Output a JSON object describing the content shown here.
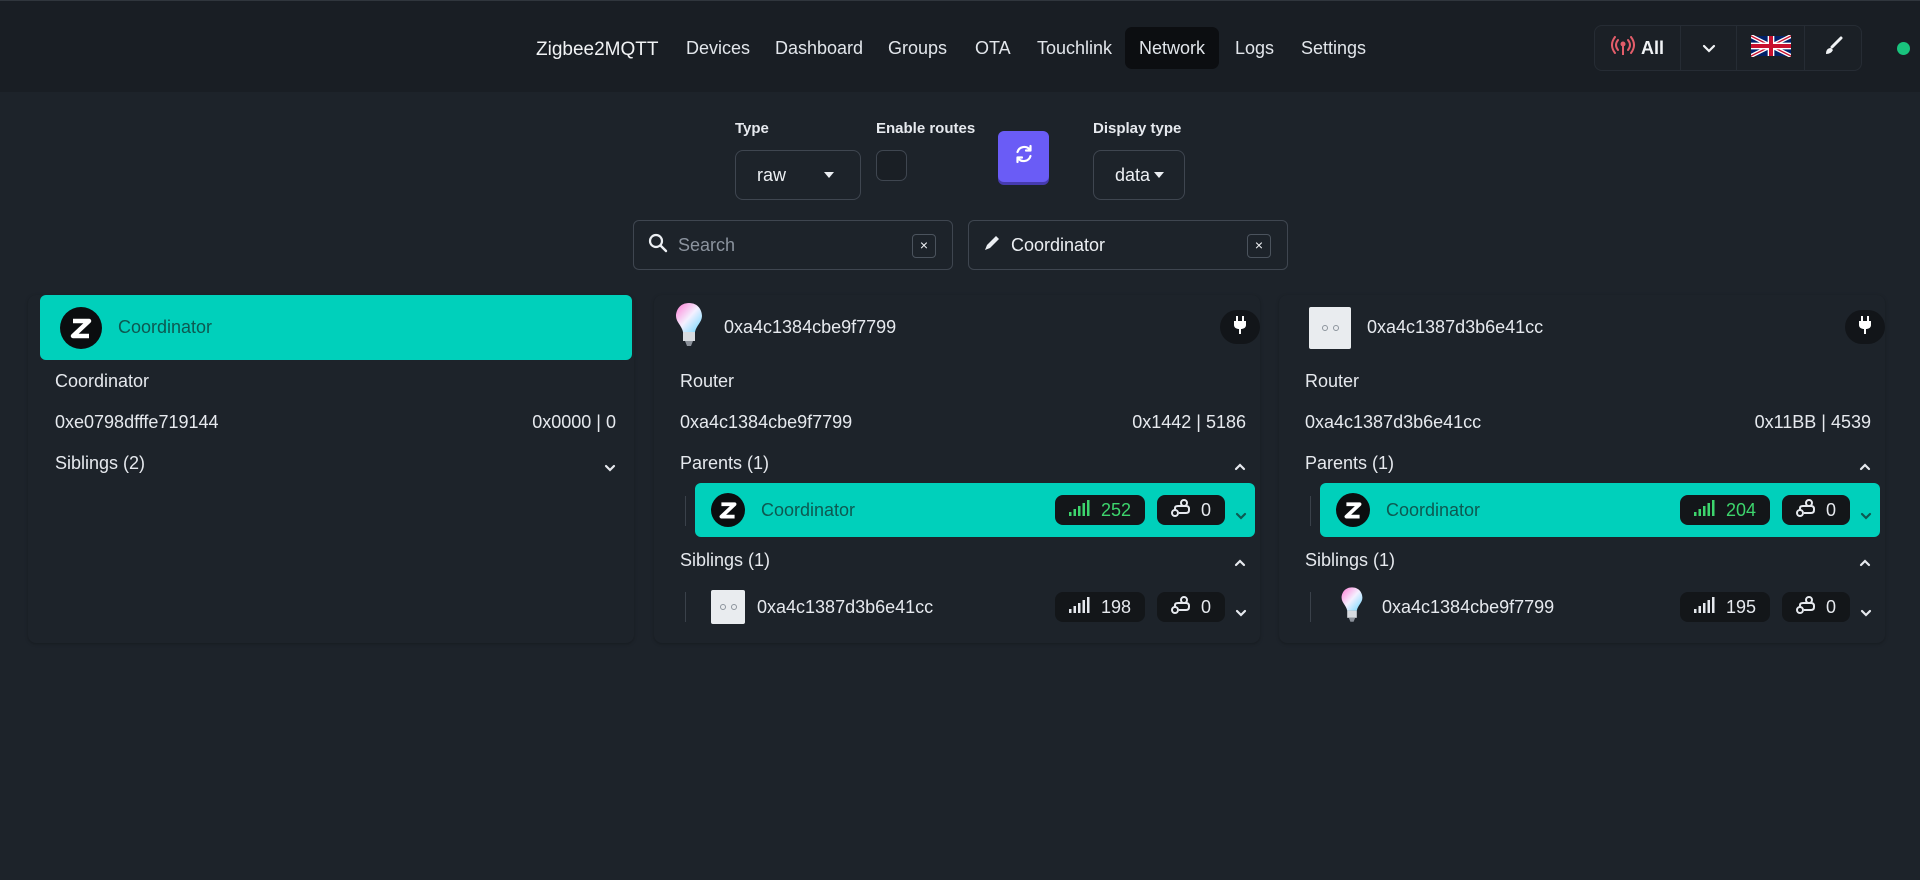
{
  "nav": {
    "brand": "Zigbee2MQTT",
    "links": [
      "Devices",
      "Dashboard",
      "Groups",
      "OTA",
      "Touchlink",
      "Network",
      "Logs",
      "Settings"
    ],
    "active": "Network",
    "permit_join_label": "All",
    "language": "English flag",
    "status_color": "#19c37d"
  },
  "form": {
    "type_label": "Type",
    "type_value": "raw",
    "enable_routes_label": "Enable routes",
    "display_type_label": "Display type",
    "display_type_value": "data",
    "search_placeholder": "Search",
    "search_value": "",
    "clear_label": "×",
    "focus_device": "Coordinator"
  },
  "cards": [
    {
      "name": "Coordinator",
      "icon": "zigbee-logo-icon",
      "type": "Coordinator",
      "ieee": "0xe0798dfffe719144",
      "addr": "0x0000 | 0",
      "siblings_label": "Siblings (2)"
    },
    {
      "name": "0xa4c1384cbe9f7799",
      "icon": "rgb-bulb-icon",
      "type": "Router",
      "ieee": "0xa4c1384cbe9f7799",
      "addr": "0x1442 | 5186",
      "parents_label": "Parents (1)",
      "parent": {
        "name": "Coordinator",
        "lqi": "252",
        "depth": "0"
      },
      "siblings_label": "Siblings (1)",
      "sibling": {
        "name": "0xa4c1387d3b6e41cc",
        "lqi": "198",
        "depth": "0"
      }
    },
    {
      "name": "0xa4c1387d3b6e41cc",
      "icon": "wall-switch-icon",
      "type": "Router",
      "ieee": "0xa4c1387d3b6e41cc",
      "addr": "0x11BB | 4539",
      "parents_label": "Parents (1)",
      "parent": {
        "name": "Coordinator",
        "lqi": "204",
        "depth": "0"
      },
      "siblings_label": "Siblings (1)",
      "sibling": {
        "name": "0xa4c1384cbe9f7799",
        "lqi": "195",
        "depth": "0"
      }
    }
  ],
  "colors": {
    "accent": "#00d0bb",
    "primary_button": "#6a5cf6",
    "lqi_good": "#3dd56d",
    "background": "#1d232a"
  }
}
